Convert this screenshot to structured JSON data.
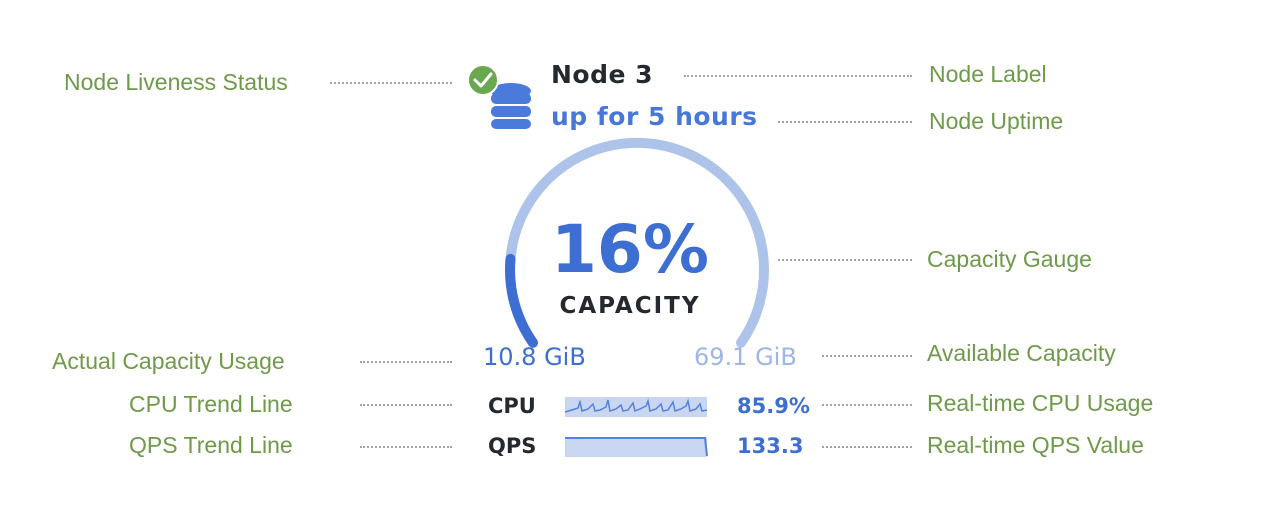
{
  "node": {
    "title": "Node 3",
    "uptime": "up for 5 hours",
    "status": "live",
    "status_icon": "check-circle-icon",
    "node_icon": "database-icon"
  },
  "gauge": {
    "percent_label": "16%",
    "percent_value": 16,
    "caption": "CAPACITY",
    "used": "10.8 GiB",
    "available": "69.1 GiB"
  },
  "metrics": {
    "cpu": {
      "name": "CPU",
      "value": "85.9%"
    },
    "qps": {
      "name": "QPS",
      "value": "133.3"
    }
  },
  "annotations": {
    "liveness": "Node Liveness Status",
    "label": "Node Label",
    "uptime": "Node Uptime",
    "gauge": "Capacity Gauge",
    "actual_usage": "Actual Capacity Usage",
    "available": "Available Capacity",
    "cpu_trend": "CPU Trend Line",
    "cpu_usage": "Real-time CPU Usage",
    "qps_trend": "QPS Trend Line",
    "qps_value": "Real-time QPS Value"
  },
  "colors": {
    "annotation_text": "#6e9a4a",
    "accent_blue": "#3d6fd3",
    "light_blue": "#aec3ea",
    "success_green": "#6aa84f",
    "dark_text": "#24292f"
  }
}
